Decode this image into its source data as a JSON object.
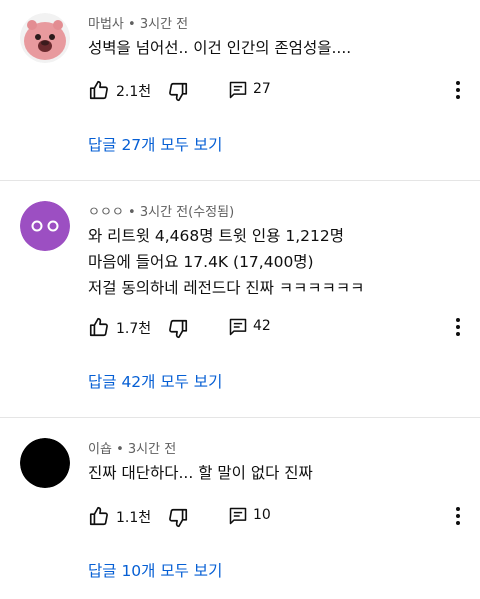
{
  "comments": [
    {
      "author": "마법사",
      "time": "3시간 전",
      "lines": [
        "성벽을 넘어선..  이건 인간의 존엄성을...."
      ],
      "likes": "2.1천",
      "replies": "27",
      "view_replies": "답글 27개 모두 보기",
      "avatar_color": "#e8a3a6"
    },
    {
      "author": "ㅇㅇㅇ",
      "time": "3시간 전(수정됨)",
      "lines": [
        "와 리트윗 4,468명 트윗 인용 1,212명",
        "마음에 들어요 17.4K (17,400명)",
        "저걸 동의하네 레전드다 진짜 ㅋㅋㅋㅋㅋㅋ"
      ],
      "likes": "1.7천",
      "replies": "42",
      "view_replies": "답글 42개 모두 보기",
      "avatar_color": "#9c4fc2"
    },
    {
      "author": "이숍",
      "time": "3시간 전",
      "lines": [
        "진짜 대단하다... 할 말이 없다 진짜"
      ],
      "likes": "1.1천",
      "replies": "10",
      "view_replies": "답글 10개 모두 보기",
      "avatar_color": "#000000"
    }
  ],
  "meta_separator": "•",
  "colors": {
    "link": "#065fd4",
    "divider": "#e5e5e5",
    "meta": "#606060"
  },
  "icons": [
    "thumb-up-icon",
    "thumb-down-icon",
    "reply-icon",
    "more-vert-icon"
  ]
}
